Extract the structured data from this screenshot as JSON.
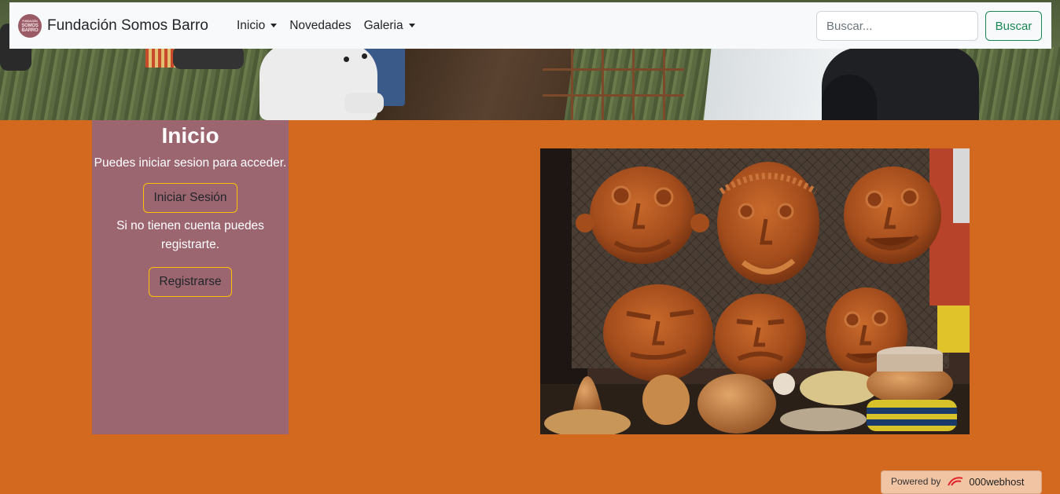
{
  "navbar": {
    "logo_lines": [
      "FUNDACIÓN",
      "SOMOS",
      "BARRO"
    ],
    "brand": "Fundación Somos Barro",
    "items": [
      {
        "label": "Inicio",
        "dropdown": true
      },
      {
        "label": "Novedades",
        "dropdown": false
      },
      {
        "label": "Galeria",
        "dropdown": true
      }
    ],
    "search_placeholder": "Buscar...",
    "search_button": "Buscar"
  },
  "panel": {
    "title": "Inicio",
    "login_text": "Puedes iniciar sesion para acceder.",
    "login_button": "Iniciar Sesión",
    "register_text": "Si no tienen cuenta puedes registrarte.",
    "register_button": "Registrarse"
  },
  "photo": {
    "subject": "clay-faces-ceramics"
  },
  "footer_badge": {
    "prefix": "Powered by",
    "brand": "000webhost"
  },
  "colors": {
    "page_background": "#d2691e",
    "panel_background": "#9c6671",
    "navbar_background": "#f8f9fa",
    "search_button": "#198754",
    "panel_button_border": "#ffc107"
  }
}
